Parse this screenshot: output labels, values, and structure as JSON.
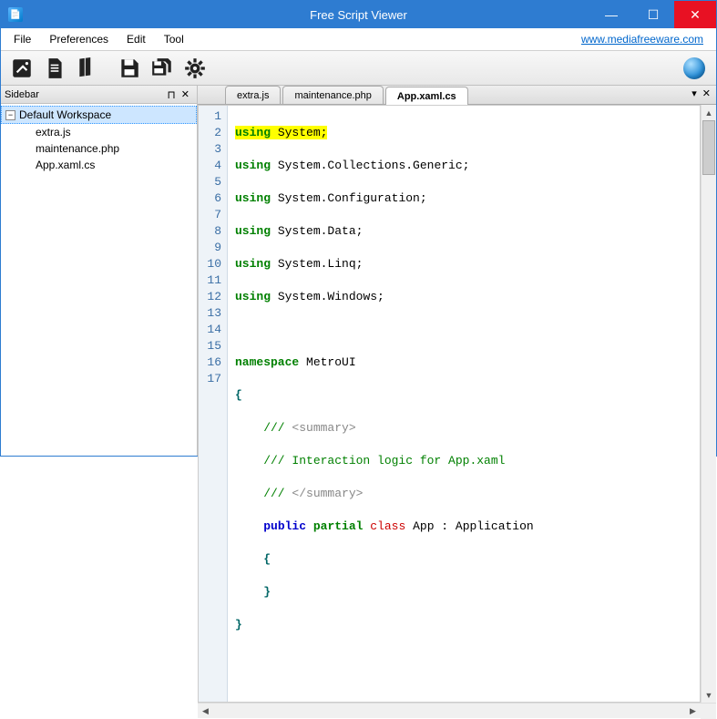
{
  "titlebar": {
    "title": "Free Script Viewer"
  },
  "menu": {
    "file": "File",
    "preferences": "Preferences",
    "edit": "Edit",
    "tool": "Tool",
    "link": "www.mediafreeware.com"
  },
  "sidebar": {
    "title": "Sidebar",
    "root": "Default Workspace",
    "toggler": "−",
    "items": [
      "extra.js",
      "maintenance.php",
      "App.xaml.cs"
    ]
  },
  "tabs": {
    "items": [
      {
        "label": "extra.js",
        "active": false
      },
      {
        "label": "maintenance.php",
        "active": false
      },
      {
        "label": "App.xaml.cs",
        "active": true
      }
    ],
    "dropdown": "▾",
    "close": "✕"
  },
  "code": {
    "lines": [
      1,
      2,
      3,
      4,
      5,
      6,
      7,
      8,
      9,
      10,
      11,
      12,
      13,
      14,
      15,
      16,
      17
    ],
    "l1_kw": "using",
    "l1_id": "System;",
    "l2_kw": "using",
    "l2_id": "System.Collections.Generic;",
    "l3_kw": "using",
    "l3_id": "System.Configuration;",
    "l4_kw": "using",
    "l4_id": "System.Data;",
    "l5_kw": "using",
    "l5_id": "System.Linq;",
    "l6_kw": "using",
    "l6_id": "System.Windows;",
    "l8_kw": "namespace",
    "l8_id": "MetroUI",
    "l9": "{",
    "l10_pre": "    /// ",
    "l10_tag": "<summary>",
    "l11": "    /// Interaction logic for App.xaml",
    "l12_pre": "    /// ",
    "l12_tag": "</summary>",
    "l13_pub": "public",
    "l13_par": "partial",
    "l13_cls": "class",
    "l13_rest": "App : Application",
    "l14": "    {",
    "l15": "    }",
    "l16": "}"
  }
}
